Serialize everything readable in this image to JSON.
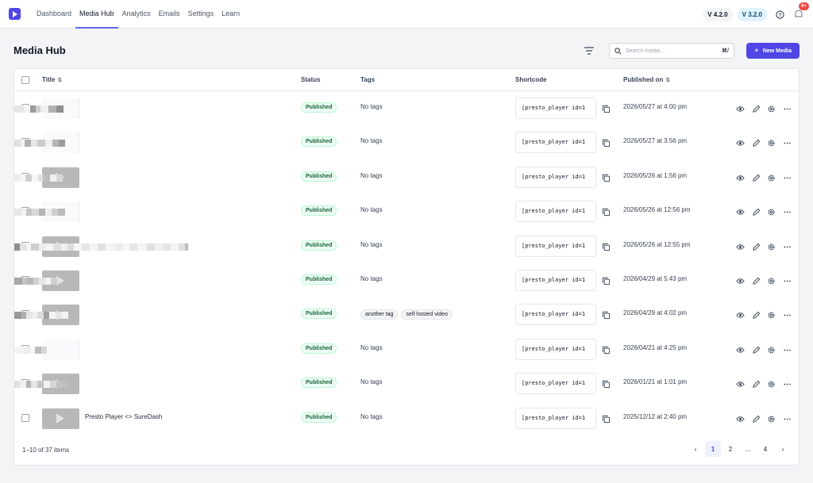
{
  "nav": {
    "items": [
      "Dashboard",
      "Media Hub",
      "Analytics",
      "Emails",
      "Settings",
      "Learn"
    ],
    "active": "Media Hub",
    "versions": [
      "V 4.2.0",
      "V 3.2.0"
    ],
    "notification_count": "9+"
  },
  "header": {
    "title": "Media Hub",
    "search_placeholder": "Search media...",
    "search_shortcut": "⌘/",
    "new_button": "New Media"
  },
  "table": {
    "columns": {
      "title": "Title",
      "status": "Status",
      "tags": "Tags",
      "shortcode": "Shortcode",
      "published": "Published on"
    },
    "rows": [
      {
        "title": "",
        "thumb": "blank",
        "status": "Published",
        "tags": [],
        "shortcode": "[presto_player id=1",
        "published": "2026/05/27 at 4:00 pm"
      },
      {
        "title": "",
        "thumb": "blank",
        "status": "Published",
        "tags": [],
        "shortcode": "[presto_player id=1",
        "published": "2026/05/27 at 3:56 pm"
      },
      {
        "title": "",
        "thumb": "img",
        "status": "Published",
        "tags": [],
        "shortcode": "[presto_player id=1",
        "published": "2026/05/26 at 1:56 pm"
      },
      {
        "title": "",
        "thumb": "blank",
        "status": "Published",
        "tags": [],
        "shortcode": "[presto_player id=1",
        "published": "2026/05/26 at 12:56 pm"
      },
      {
        "title": "",
        "thumb": "img",
        "status": "Published",
        "tags": [],
        "shortcode": "[presto_player id=1",
        "published": "2026/05/26 at 12:55 pm"
      },
      {
        "title": "",
        "thumb": "img",
        "status": "Published",
        "tags": [],
        "shortcode": "[presto_player id=1",
        "published": "2026/04/29 at 5:43 pm"
      },
      {
        "title": "",
        "thumb": "img",
        "status": "Published",
        "tags": [
          "another tag",
          "self hosted video"
        ],
        "shortcode": "[presto_player id=1",
        "published": "2026/04/29 at 4:02 pm"
      },
      {
        "title": "",
        "thumb": "blank",
        "status": "Published",
        "tags": [],
        "shortcode": "[presto_player id=1",
        "published": "2026/04/21 at 4:25 pm"
      },
      {
        "title": "",
        "thumb": "img",
        "status": "Published",
        "tags": [],
        "shortcode": "[presto_player id=1",
        "published": "2026/01/21 at 1:01 pm"
      },
      {
        "title": "Presto Player <> SureDash",
        "thumb": "img",
        "status": "Published",
        "tags": [],
        "shortcode": "[presto_player id=1",
        "published": "2025/12/12 at 2:40 pm"
      }
    ],
    "no_tags_label": "No tags"
  },
  "footer": {
    "count": "1–10 of 37 items",
    "pages": [
      "1",
      "2",
      "…",
      "4"
    ],
    "active_page": "1"
  },
  "icons": {
    "actions": [
      "eye-icon",
      "pencil-icon",
      "gear-icon",
      "more-icon"
    ]
  },
  "colors": {
    "accent": "#4f46e5",
    "status_green": "#166534"
  }
}
